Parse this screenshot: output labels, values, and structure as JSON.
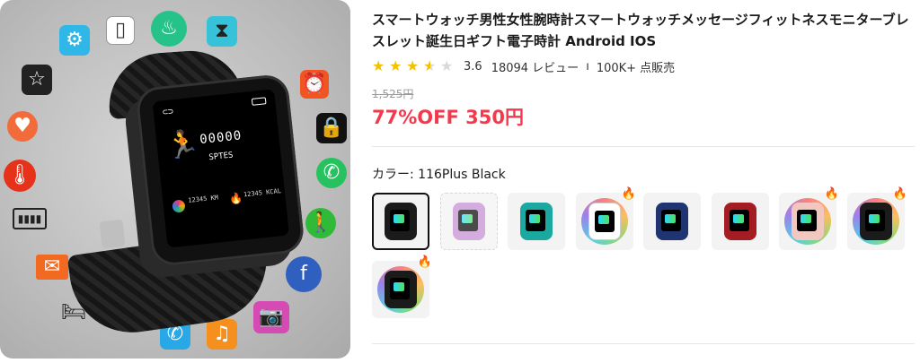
{
  "product": {
    "title": "スマートウォッチ男性女性腕時計スマートウォッチメッセージフィットネスモニターブレスレット誕生日ギフト電子時計 Android IOS",
    "rating_value": "3.6",
    "rating_stars": 3.6,
    "review_count": "18094 レビュー",
    "separator": "ı",
    "sold_count": "100K+ 点販売",
    "original_price": "1,525円",
    "discount_price": "77%OFF 350円"
  },
  "variant": {
    "label": "カラー: 116Plus Black",
    "swatches": [
      {
        "color": "#1b1b1b",
        "selected": true,
        "ring": false,
        "hot": false,
        "dashed": false
      },
      {
        "color": "#c28ad1",
        "selected": false,
        "ring": false,
        "hot": false,
        "dashed": true
      },
      {
        "color": "#1aa8a0",
        "selected": false,
        "ring": false,
        "hot": false,
        "dashed": false
      },
      {
        "color": "#ffffff",
        "selected": false,
        "ring": true,
        "hot": true,
        "dashed": false
      },
      {
        "color": "#1f3470",
        "selected": false,
        "ring": false,
        "hot": false,
        "dashed": false
      },
      {
        "color": "#a31d22",
        "selected": false,
        "ring": false,
        "hot": false,
        "dashed": false
      },
      {
        "color": "#f2c7c0",
        "selected": false,
        "ring": true,
        "hot": true,
        "dashed": false
      },
      {
        "color": "#1b1b1b",
        "selected": false,
        "ring": true,
        "hot": true,
        "dashed": false
      },
      {
        "color": "#1b1b1b",
        "selected": false,
        "ring": true,
        "hot": true,
        "dashed": false
      }
    ]
  },
  "hero": {
    "screen_digits": "00000",
    "screen_label": "SPTES",
    "screen_stat_left": "12345 KM",
    "screen_stat_right": "12345 KCAL"
  },
  "colors": {
    "price": "#f5394c",
    "star": "#f2c200",
    "hot": "#e8242c"
  }
}
